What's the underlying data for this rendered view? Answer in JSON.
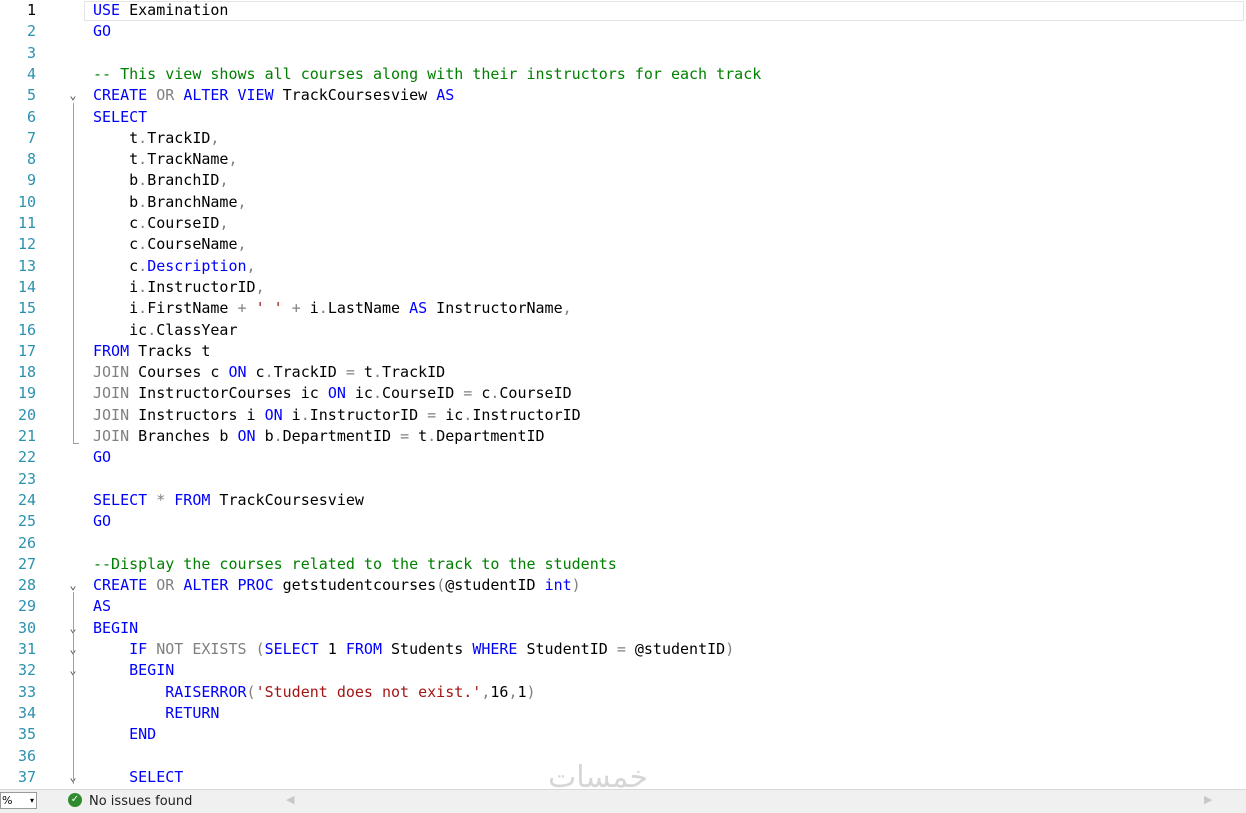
{
  "editor": {
    "current_line": 1,
    "lines": [
      {
        "n": "1",
        "fold": "",
        "code": [
          {
            "c": "kw",
            "t": "USE"
          },
          {
            "c": "",
            "t": " Examination"
          }
        ]
      },
      {
        "n": "2",
        "fold": "",
        "code": [
          {
            "c": "kw",
            "t": "GO"
          }
        ]
      },
      {
        "n": "3",
        "fold": "",
        "code": []
      },
      {
        "n": "4",
        "fold": "",
        "code": [
          {
            "c": "cm",
            "t": "-- This view shows all courses along with their instructors for each track"
          }
        ]
      },
      {
        "n": "5",
        "fold": "⌄",
        "code": [
          {
            "c": "kw",
            "t": "CREATE"
          },
          {
            "c": "",
            "t": " "
          },
          {
            "c": "gr",
            "t": "OR"
          },
          {
            "c": "",
            "t": " "
          },
          {
            "c": "kw",
            "t": "ALTER VIEW"
          },
          {
            "c": "",
            "t": " TrackCoursesview "
          },
          {
            "c": "kw",
            "t": "AS"
          }
        ]
      },
      {
        "n": "6",
        "fold": "",
        "code": [
          {
            "c": "kw",
            "t": "SELECT"
          }
        ]
      },
      {
        "n": "7",
        "fold": "",
        "code": [
          {
            "c": "",
            "t": "    t"
          },
          {
            "c": "gr",
            "t": "."
          },
          {
            "c": "",
            "t": "TrackID"
          },
          {
            "c": "gr",
            "t": ","
          }
        ]
      },
      {
        "n": "8",
        "fold": "",
        "code": [
          {
            "c": "",
            "t": "    t"
          },
          {
            "c": "gr",
            "t": "."
          },
          {
            "c": "",
            "t": "TrackName"
          },
          {
            "c": "gr",
            "t": ","
          }
        ]
      },
      {
        "n": "9",
        "fold": "",
        "code": [
          {
            "c": "",
            "t": "    b"
          },
          {
            "c": "gr",
            "t": "."
          },
          {
            "c": "",
            "t": "BranchID"
          },
          {
            "c": "gr",
            "t": ","
          }
        ]
      },
      {
        "n": "10",
        "fold": "",
        "code": [
          {
            "c": "",
            "t": "    b"
          },
          {
            "c": "gr",
            "t": "."
          },
          {
            "c": "",
            "t": "BranchName"
          },
          {
            "c": "gr",
            "t": ","
          }
        ]
      },
      {
        "n": "11",
        "fold": "",
        "code": [
          {
            "c": "",
            "t": "    c"
          },
          {
            "c": "gr",
            "t": "."
          },
          {
            "c": "",
            "t": "CourseID"
          },
          {
            "c": "gr",
            "t": ","
          }
        ]
      },
      {
        "n": "12",
        "fold": "",
        "code": [
          {
            "c": "",
            "t": "    c"
          },
          {
            "c": "gr",
            "t": "."
          },
          {
            "c": "",
            "t": "CourseName"
          },
          {
            "c": "gr",
            "t": ","
          }
        ]
      },
      {
        "n": "13",
        "fold": "",
        "code": [
          {
            "c": "",
            "t": "    c"
          },
          {
            "c": "gr",
            "t": "."
          },
          {
            "c": "kw",
            "t": "Description"
          },
          {
            "c": "gr",
            "t": ","
          }
        ]
      },
      {
        "n": "14",
        "fold": "",
        "code": [
          {
            "c": "",
            "t": "    i"
          },
          {
            "c": "gr",
            "t": "."
          },
          {
            "c": "",
            "t": "InstructorID"
          },
          {
            "c": "gr",
            "t": ","
          }
        ]
      },
      {
        "n": "15",
        "fold": "",
        "code": [
          {
            "c": "",
            "t": "    i"
          },
          {
            "c": "gr",
            "t": "."
          },
          {
            "c": "",
            "t": "FirstName "
          },
          {
            "c": "gr",
            "t": "+"
          },
          {
            "c": "",
            "t": " "
          },
          {
            "c": "st",
            "t": "' '"
          },
          {
            "c": "",
            "t": " "
          },
          {
            "c": "gr",
            "t": "+"
          },
          {
            "c": "",
            "t": " i"
          },
          {
            "c": "gr",
            "t": "."
          },
          {
            "c": "",
            "t": "LastName "
          },
          {
            "c": "kw",
            "t": "AS"
          },
          {
            "c": "",
            "t": " InstructorName"
          },
          {
            "c": "gr",
            "t": ","
          }
        ]
      },
      {
        "n": "16",
        "fold": "",
        "code": [
          {
            "c": "",
            "t": "    ic"
          },
          {
            "c": "gr",
            "t": "."
          },
          {
            "c": "",
            "t": "ClassYear"
          }
        ]
      },
      {
        "n": "17",
        "fold": "",
        "code": [
          {
            "c": "kw",
            "t": "FROM"
          },
          {
            "c": "",
            "t": " Tracks t"
          }
        ]
      },
      {
        "n": "18",
        "fold": "",
        "code": [
          {
            "c": "gr",
            "t": "JOIN"
          },
          {
            "c": "",
            "t": " Courses c "
          },
          {
            "c": "kw",
            "t": "ON"
          },
          {
            "c": "",
            "t": " c"
          },
          {
            "c": "gr",
            "t": "."
          },
          {
            "c": "",
            "t": "TrackID "
          },
          {
            "c": "gr",
            "t": "="
          },
          {
            "c": "",
            "t": " t"
          },
          {
            "c": "gr",
            "t": "."
          },
          {
            "c": "",
            "t": "TrackID"
          }
        ]
      },
      {
        "n": "19",
        "fold": "",
        "code": [
          {
            "c": "gr",
            "t": "JOIN"
          },
          {
            "c": "",
            "t": " InstructorCourses ic "
          },
          {
            "c": "kw",
            "t": "ON"
          },
          {
            "c": "",
            "t": " ic"
          },
          {
            "c": "gr",
            "t": "."
          },
          {
            "c": "",
            "t": "CourseID "
          },
          {
            "c": "gr",
            "t": "="
          },
          {
            "c": "",
            "t": " c"
          },
          {
            "c": "gr",
            "t": "."
          },
          {
            "c": "",
            "t": "CourseID"
          }
        ]
      },
      {
        "n": "20",
        "fold": "",
        "code": [
          {
            "c": "gr",
            "t": "JOIN"
          },
          {
            "c": "",
            "t": " Instructors i "
          },
          {
            "c": "kw",
            "t": "ON"
          },
          {
            "c": "",
            "t": " i"
          },
          {
            "c": "gr",
            "t": "."
          },
          {
            "c": "",
            "t": "InstructorID "
          },
          {
            "c": "gr",
            "t": "="
          },
          {
            "c": "",
            "t": " ic"
          },
          {
            "c": "gr",
            "t": "."
          },
          {
            "c": "",
            "t": "InstructorID"
          }
        ]
      },
      {
        "n": "21",
        "fold": "",
        "code": [
          {
            "c": "gr",
            "t": "JOIN"
          },
          {
            "c": "",
            "t": " Branches b "
          },
          {
            "c": "kw",
            "t": "ON"
          },
          {
            "c": "",
            "t": " b"
          },
          {
            "c": "gr",
            "t": "."
          },
          {
            "c": "",
            "t": "DepartmentID "
          },
          {
            "c": "gr",
            "t": "="
          },
          {
            "c": "",
            "t": " t"
          },
          {
            "c": "gr",
            "t": "."
          },
          {
            "c": "",
            "t": "DepartmentID"
          }
        ]
      },
      {
        "n": "22",
        "fold": "",
        "code": [
          {
            "c": "kw",
            "t": "GO"
          }
        ]
      },
      {
        "n": "23",
        "fold": "",
        "code": []
      },
      {
        "n": "24",
        "fold": "",
        "code": [
          {
            "c": "kw",
            "t": "SELECT"
          },
          {
            "c": "",
            "t": " "
          },
          {
            "c": "gr",
            "t": "*"
          },
          {
            "c": "",
            "t": " "
          },
          {
            "c": "kw",
            "t": "FROM"
          },
          {
            "c": "",
            "t": " TrackCoursesview"
          }
        ]
      },
      {
        "n": "25",
        "fold": "",
        "code": [
          {
            "c": "kw",
            "t": "GO"
          }
        ]
      },
      {
        "n": "26",
        "fold": "",
        "code": []
      },
      {
        "n": "27",
        "fold": "",
        "code": [
          {
            "c": "cm",
            "t": "--Display the courses related to the track to the students"
          }
        ]
      },
      {
        "n": "28",
        "fold": "⌄",
        "code": [
          {
            "c": "kw",
            "t": "CREATE"
          },
          {
            "c": "",
            "t": " "
          },
          {
            "c": "gr",
            "t": "OR"
          },
          {
            "c": "",
            "t": " "
          },
          {
            "c": "kw",
            "t": "ALTER PROC"
          },
          {
            "c": "",
            "t": " getstudentcourses"
          },
          {
            "c": "gr",
            "t": "("
          },
          {
            "c": "",
            "t": "@studentID "
          },
          {
            "c": "kw",
            "t": "int"
          },
          {
            "c": "gr",
            "t": ")"
          }
        ]
      },
      {
        "n": "29",
        "fold": "",
        "code": [
          {
            "c": "kw",
            "t": "AS"
          }
        ]
      },
      {
        "n": "30",
        "fold": "⌄",
        "code": [
          {
            "c": "kw",
            "t": "BEGIN"
          }
        ]
      },
      {
        "n": "31",
        "fold": "⌄",
        "code": [
          {
            "c": "",
            "t": "    "
          },
          {
            "c": "kw",
            "t": "IF"
          },
          {
            "c": "",
            "t": " "
          },
          {
            "c": "gr",
            "t": "NOT EXISTS"
          },
          {
            "c": "",
            "t": " "
          },
          {
            "c": "gr",
            "t": "("
          },
          {
            "c": "kw",
            "t": "SELECT"
          },
          {
            "c": "",
            "t": " 1 "
          },
          {
            "c": "kw",
            "t": "FROM"
          },
          {
            "c": "",
            "t": " Students "
          },
          {
            "c": "kw",
            "t": "WHERE"
          },
          {
            "c": "",
            "t": " StudentID "
          },
          {
            "c": "gr",
            "t": "="
          },
          {
            "c": "",
            "t": " @studentID"
          },
          {
            "c": "gr",
            "t": ")"
          }
        ]
      },
      {
        "n": "32",
        "fold": "⌄",
        "code": [
          {
            "c": "",
            "t": "    "
          },
          {
            "c": "kw",
            "t": "BEGIN"
          }
        ]
      },
      {
        "n": "33",
        "fold": "",
        "code": [
          {
            "c": "",
            "t": "        "
          },
          {
            "c": "kw",
            "t": "RAISERROR"
          },
          {
            "c": "gr",
            "t": "("
          },
          {
            "c": "st",
            "t": "'Student does not exist.'"
          },
          {
            "c": "gr",
            "t": ","
          },
          {
            "c": "",
            "t": "16"
          },
          {
            "c": "gr",
            "t": ","
          },
          {
            "c": "",
            "t": "1"
          },
          {
            "c": "gr",
            "t": ")"
          }
        ]
      },
      {
        "n": "34",
        "fold": "",
        "code": [
          {
            "c": "",
            "t": "        "
          },
          {
            "c": "kw",
            "t": "RETURN"
          }
        ]
      },
      {
        "n": "35",
        "fold": "",
        "code": [
          {
            "c": "",
            "t": "    "
          },
          {
            "c": "kw",
            "t": "END"
          }
        ]
      },
      {
        "n": "36",
        "fold": "",
        "code": []
      },
      {
        "n": "37",
        "fold": "⌄",
        "code": [
          {
            "c": "",
            "t": "    "
          },
          {
            "c": "kw",
            "t": "SELECT"
          }
        ]
      }
    ]
  },
  "status_bar": {
    "zoom_value": "%",
    "zoom_arrow": "▾",
    "issues_icon": "check-circle-icon",
    "issues_glyph": "✓",
    "issues_text": "No issues found",
    "scroll_left": "◀",
    "scroll_right": "▶"
  },
  "watermark": {
    "text": "خمسات"
  }
}
